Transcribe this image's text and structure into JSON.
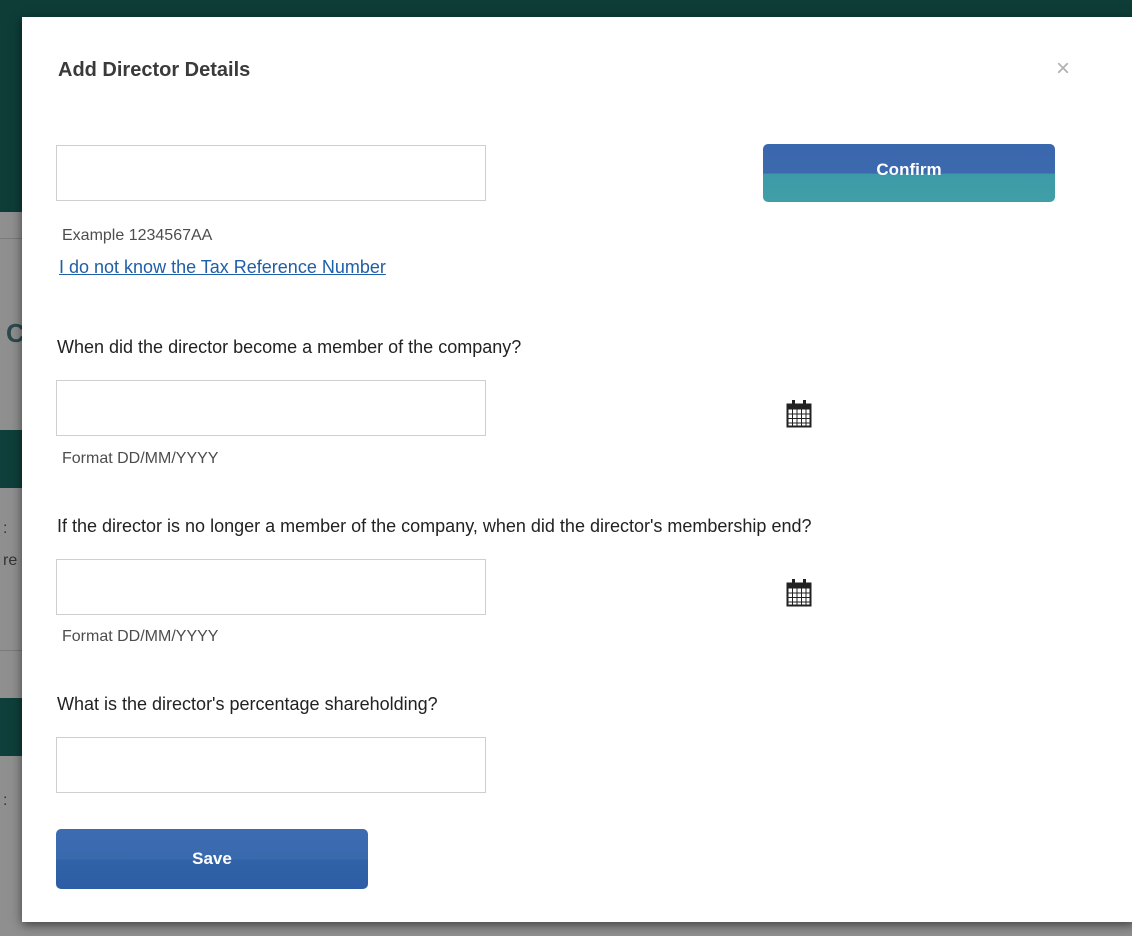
{
  "modal": {
    "title": "Add Director Details",
    "close_glyph": "×"
  },
  "tax_ref": {
    "value": "",
    "placeholder": "",
    "hint": "Example 1234567AA",
    "unknown_link": "I do not know the Tax Reference Number",
    "confirm_label": "Confirm"
  },
  "start_date": {
    "question": "When did the director become a member of the company?",
    "value": "",
    "hint": "Format DD/MM/YYYY",
    "icon": "calendar-icon"
  },
  "end_date": {
    "question": "If the director is no longer a member of the company, when did the director's membership end?",
    "value": "",
    "hint": "Format DD/MM/YYYY",
    "icon": "calendar-icon"
  },
  "shareholding": {
    "question": "What is the director's percentage shareholding?",
    "value": ""
  },
  "save_label": "Save",
  "colors": {
    "background_header": "#0e3d38",
    "button_blue": "#3a68ad",
    "button_teal": "#3f9fa6",
    "link": "#1f5ea8"
  }
}
